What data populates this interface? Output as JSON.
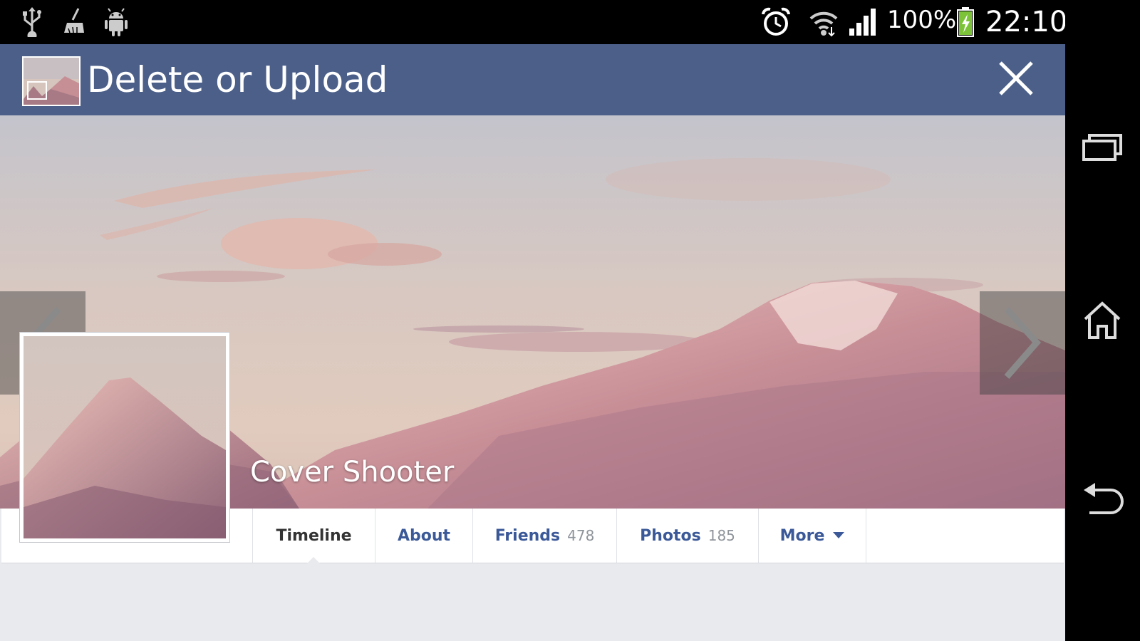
{
  "status_bar": {
    "battery_percent": "100%",
    "time": "22:10",
    "icons_left": [
      "usb-icon",
      "cleaner-icon",
      "android-icon"
    ],
    "icons_right": [
      "alarm-icon",
      "wifi-icon",
      "signal-icon",
      "battery-charging-icon"
    ]
  },
  "app_bar": {
    "title": "Delete or Upload",
    "close_icon": "close-icon",
    "accent": "#4b5f89"
  },
  "profile": {
    "name": "Cover Shooter"
  },
  "tabs": [
    {
      "label": "Timeline",
      "count": "",
      "active": true
    },
    {
      "label": "About",
      "count": ""
    },
    {
      "label": "Friends",
      "count": "478"
    },
    {
      "label": "Photos",
      "count": "185"
    },
    {
      "label": "More",
      "count": "",
      "icon": "caret-down-icon"
    }
  ],
  "colors": {
    "link_blue": "#3b5998",
    "page_bg": "#e9eaed"
  },
  "system_nav": [
    "recent-apps-icon",
    "home-icon",
    "back-icon"
  ]
}
